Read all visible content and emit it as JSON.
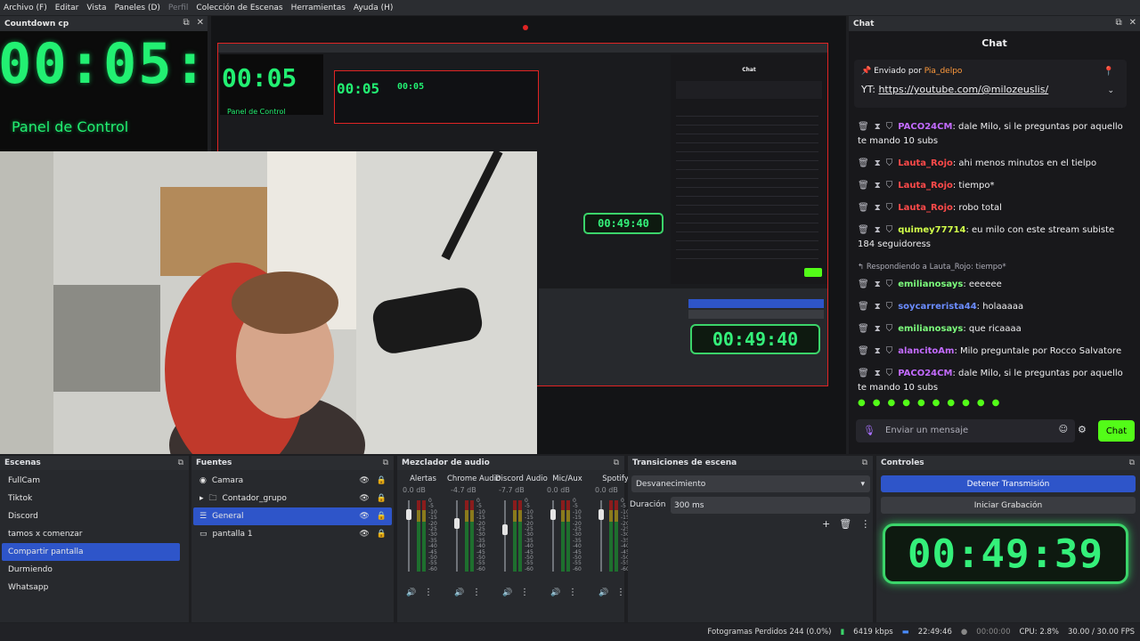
{
  "menu": [
    "Archivo (F)",
    "Editar",
    "Vista",
    "Paneles (D)",
    "Perfil",
    "Colección de Escenas",
    "Herramientas",
    "Ayuda (H)"
  ],
  "countdown_dock": {
    "title": "Countdown cp",
    "time": "00:05:",
    "label": "Panel de Control"
  },
  "chat_dock": {
    "title": "Chat",
    "heading": "Chat",
    "pinned_by": "Enviado por",
    "pinned_user": "Pia_delpo",
    "pinned_prefix": "YT:",
    "pinned_link": "https://youtube.com/@milozeuslis/",
    "messages": [
      {
        "user": "PACO24CM",
        "color": "#c36bff",
        "text": ": dale Milo, si le preguntas por aquello te mando 10 subs"
      },
      {
        "user": "Lauta_Rojo",
        "color": "#ff4a4a",
        "text": ": ahi menos minutos en el tielpo"
      },
      {
        "user": "Lauta_Rojo",
        "color": "#ff4a4a",
        "text": ": tiempo*"
      },
      {
        "user": "Lauta_Rojo",
        "color": "#ff4a4a",
        "text": ": robo total"
      },
      {
        "user": "quimey77714",
        "color": "#d2ff4a",
        "text": ": eu milo con este stream subiste 184 seguidoress"
      }
    ],
    "reply_note": "Respondiendo a Lauta_Rojo: tiempo*",
    "messages2": [
      {
        "user": "emilianosays",
        "color": "#7cfc7c",
        "text": ": eeeeee"
      },
      {
        "user": "soycarrerista44",
        "color": "#6b8cff",
        "text": ": holaaaaa"
      },
      {
        "user": "emilianosays",
        "color": "#7cfc7c",
        "text": ": que ricaaaa"
      },
      {
        "user": "alancitoAm",
        "color": "#c36bff",
        "text": ": Milo preguntale por Rocco Salvatore"
      },
      {
        "user": "PACO24CM",
        "color": "#c36bff",
        "text": ": dale Milo, si le preguntas por aquello te mando 10 subs"
      }
    ],
    "input_placeholder": "Enviar un mensaje",
    "send_label": "Chat"
  },
  "scenes": {
    "title": "Escenas",
    "items": [
      "FullCam",
      "Tiktok",
      "Discord",
      "tamos x comenzar",
      "Compartir pantalla",
      "Durmiendo",
      "Whatsapp"
    ],
    "selected": "Compartir pantalla"
  },
  "sources": {
    "title": "Fuentes",
    "items": [
      {
        "label": "Camara",
        "icon": "camera-icon"
      },
      {
        "label": "Contador_grupo",
        "icon": "folder-icon"
      },
      {
        "label": "General",
        "icon": "text-icon"
      },
      {
        "label": "pantalla 1",
        "icon": "monitor-icon"
      }
    ],
    "selected": "General"
  },
  "mixer": {
    "title": "Mezclador de audio",
    "channels": [
      {
        "name": "Alertas",
        "db": "0.0 dB",
        "level": 0.85
      },
      {
        "name": "Chrome Audio",
        "db": "-4.7 dB",
        "level": 0.7
      },
      {
        "name": "Discord Audio",
        "db": "-7.7 dB",
        "level": 0.6
      },
      {
        "name": "Mic/Aux",
        "db": "0.0 dB",
        "level": 0.85
      },
      {
        "name": "Spotify",
        "db": "0.0 dB",
        "level": 0.85
      }
    ],
    "scale": [
      "0",
      "-5",
      "-10",
      "-15",
      "-20",
      "-25",
      "-30",
      "-35",
      "-40",
      "-45",
      "-50",
      "-55",
      "-60"
    ]
  },
  "transitions": {
    "title": "Transiciones de escena",
    "current": "Desvanecimiento",
    "duration_label": "Duración",
    "duration_value": "300 ms"
  },
  "controls": {
    "title": "Controles",
    "stop_stream": "Detener Transmisión",
    "start_record": "Iniciar Grabación",
    "timer": "00:49:39"
  },
  "status": {
    "dropped": "Fotogramas Perdidos 244 (0.0%)",
    "bitrate": "6419 kbps",
    "stream_time": "22:49:46",
    "rec_time": "00:00:00",
    "cpu": "CPU: 2.8%",
    "fps": "30.00 / 30.00 FPS"
  },
  "colors": {
    "accent": "#2e55c9",
    "timer_green": "#22f072",
    "chat_green": "#53fc18"
  }
}
